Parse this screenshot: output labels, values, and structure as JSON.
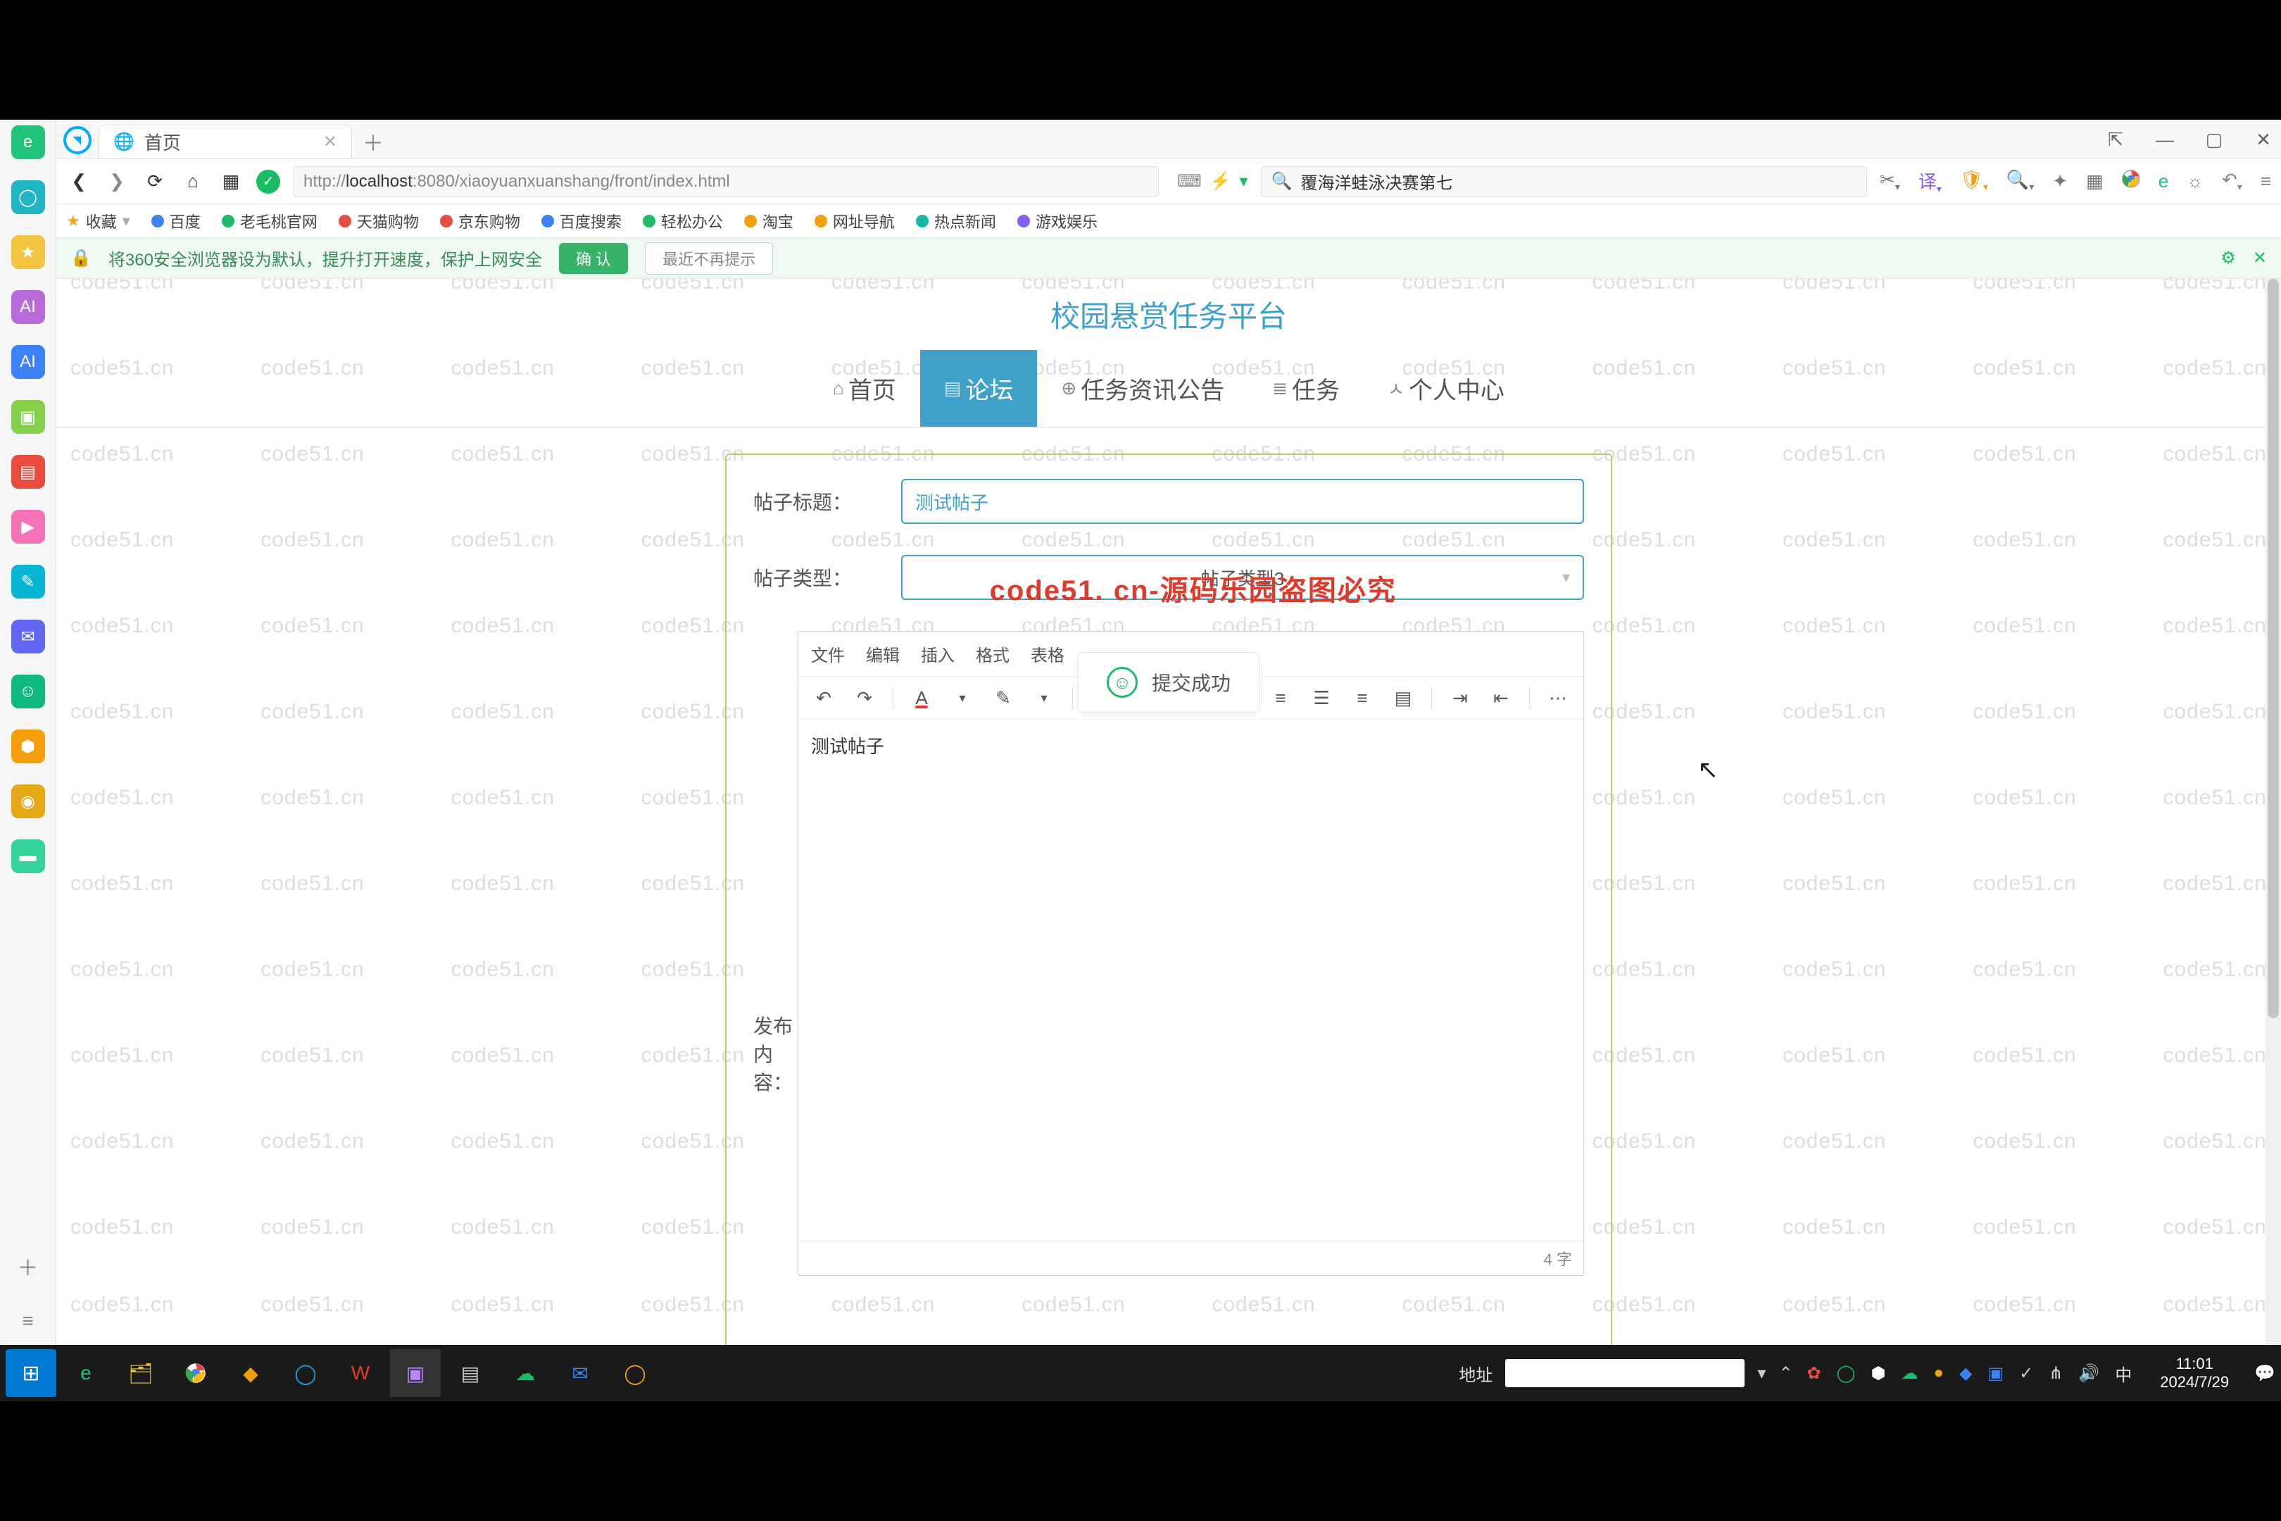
{
  "browser": {
    "tab_title": "首页",
    "new_tab_icon": "＋",
    "window": {
      "pin": "⇱",
      "min": "—",
      "max": "▢",
      "close": "✕"
    },
    "url_prefix": "http://",
    "url_host": "localhost",
    "url_port": ":8080",
    "url_path": "/xiaoyuanxuanshang/front/index.html",
    "search_text": "覆海洋蛙泳决赛第七",
    "bookmarks": {
      "fav": "收藏",
      "items": [
        "百度",
        "老毛桃官网",
        "天猫购物",
        "京东购物",
        "百度搜索",
        "轻松办公",
        "淘宝",
        "网址导航",
        "热点新闻",
        "游戏娱乐"
      ]
    },
    "notice": {
      "text": "将360安全浏览器设为默认，提升打开速度，保护上网安全",
      "confirm": "确 认",
      "later": "最近不再提示"
    }
  },
  "site": {
    "title": "校园悬赏任务平台",
    "nav": {
      "home": "首页",
      "forum": "论坛",
      "announce": "任务资讯公告",
      "task": "任务",
      "profile": "个人中心"
    }
  },
  "form": {
    "title_label": "帖子标题：",
    "title_value": "测试帖子",
    "type_label": "帖子类型：",
    "type_value": "帖子类型3",
    "content_label": "发布内容：",
    "editor": {
      "menu": {
        "file": "文件",
        "edit": "编辑",
        "insert": "插入",
        "format": "格式",
        "table": "表格"
      },
      "body_text": "测试帖子",
      "char_count": "4 字"
    }
  },
  "toast": {
    "text": "提交成功"
  },
  "overlay_watermark": "code51. cn-源码乐园盗图必究",
  "wm_text": "code51.cn",
  "taskbar": {
    "addr_label": "地址",
    "time": "11:01",
    "date": "2024/7/29"
  }
}
